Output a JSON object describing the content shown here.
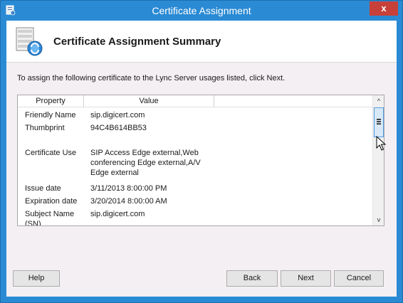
{
  "window": {
    "title": "Certificate Assignment",
    "close_label": "x"
  },
  "header": {
    "title": "Certificate Assignment Summary"
  },
  "instruction": "To assign the following certificate to the Lync Server usages listed, click Next.",
  "list": {
    "columns": [
      "Property",
      "Value",
      ""
    ],
    "rows": [
      {
        "property": "Friendly Name",
        "value": "sip.digicert.com"
      },
      {
        "property": "Thumbprint",
        "value": "94C4B614BB53"
      },
      {
        "property": "Certificate Use",
        "value": "SIP Access Edge external,Web conferencing Edge external,A/V Edge external"
      },
      {
        "property": "Issue date",
        "value": "3/11/2013 8:00:00 PM"
      },
      {
        "property": "Expiration date",
        "value": "3/20/2014 8:00:00 AM"
      },
      {
        "property": "Subject Name (SN)",
        "value": "sip.digicert.com"
      }
    ]
  },
  "scrollbar": {
    "up_glyph": "^",
    "down_glyph": "v"
  },
  "buttons": {
    "help": "Help",
    "back": "Back",
    "next": "Next",
    "cancel": "Cancel"
  },
  "icons": {
    "title": "certificate-icon",
    "header": "certificate-assignment-icon",
    "cursor": "mouse-pointer-icon"
  },
  "colors": {
    "title_bar": "#2a8ad4",
    "close_button": "#c7413a",
    "client_background": "#f4eff3"
  }
}
